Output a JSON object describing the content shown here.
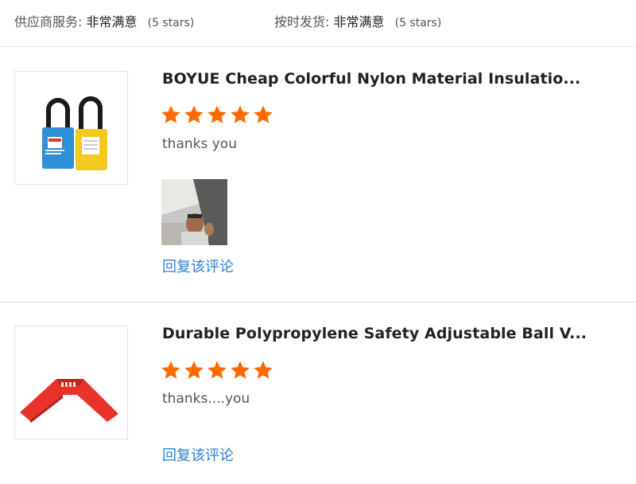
{
  "store_ratings": [
    {
      "label": "供应商服务:",
      "value": "非常满意",
      "stars_note": "(5 stars)"
    },
    {
      "label": "按时发货:",
      "value": "非常满意",
      "stars_note": "(5 stars)"
    }
  ],
  "reviews": [
    {
      "product_title": "BOYUE Cheap Colorful Nylon Material Insulatio...",
      "product_image_icon": "padlock-icon",
      "rating": 5,
      "rating_max": 5,
      "star_color": "#ff6a00",
      "comment": "thanks you",
      "has_photo": true,
      "reply_label": "回复该评论"
    },
    {
      "product_title": "Durable Polypropylene Safety Adjustable Ball V...",
      "product_image_icon": "valve-lockout-icon",
      "rating": 5,
      "rating_max": 5,
      "star_color": "#ff6a00",
      "comment": "thanks....you",
      "has_photo": false,
      "reply_label": "回复该评论"
    }
  ],
  "colors": {
    "link": "#2e7fd3",
    "star": "#ff6a00",
    "divider": "#d6d6d6"
  }
}
